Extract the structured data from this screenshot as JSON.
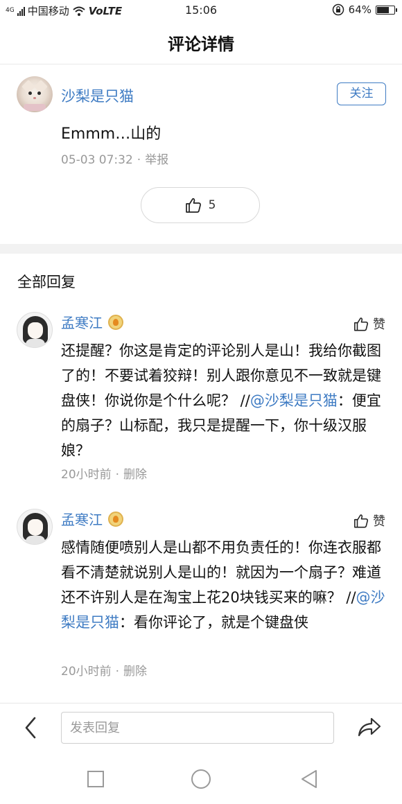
{
  "status_bar": {
    "network_type": "4G",
    "carrier": "中国移动",
    "volte": "VoLTE",
    "time": "15:06",
    "battery_percent": "64%",
    "battery_level": 0.64
  },
  "navbar": {
    "title": "评论详情"
  },
  "main_comment": {
    "author": "沙梨是只猫",
    "follow_label": "关注",
    "text": "Emmm…山的",
    "time": "05-03 07:32",
    "separator": "·",
    "report_label": "举报",
    "like_count": "5"
  },
  "section": {
    "title": "全部回复"
  },
  "replies": [
    {
      "author": "孟寒江",
      "like_label": "赞",
      "text_before": "还提醒？你这是肯定的评论别人是山！我给你截图了的！不要试着狡辩！别人跟你意见不一致就是键盘侠！你说你是个什么呢？ //",
      "mention": "@沙梨是只猫",
      "text_after": "：便宜的扇子？山标配，我只是提醒一下，你十级汉服娘？",
      "time": "20小时前",
      "separator": "·",
      "delete_label": "删除"
    },
    {
      "author": "孟寒江",
      "like_label": "赞",
      "text_before": "感情随便喷别人是山都不用负责任的！你连衣服都看不清楚就说别人是山的！就因为一个扇子？难道还不许别人是在淘宝上花20块钱买来的嘛？ //",
      "mention": "@沙梨是只猫",
      "text_after": "：看你评论了，就是个键盘侠",
      "time": "20小时前",
      "separator": "·",
      "delete_label": "删除"
    }
  ],
  "bottom_bar": {
    "input_placeholder": "发表回复"
  },
  "colors": {
    "link": "#3e7bc3",
    "meta": "#999999",
    "divider": "#f2f2f2"
  }
}
